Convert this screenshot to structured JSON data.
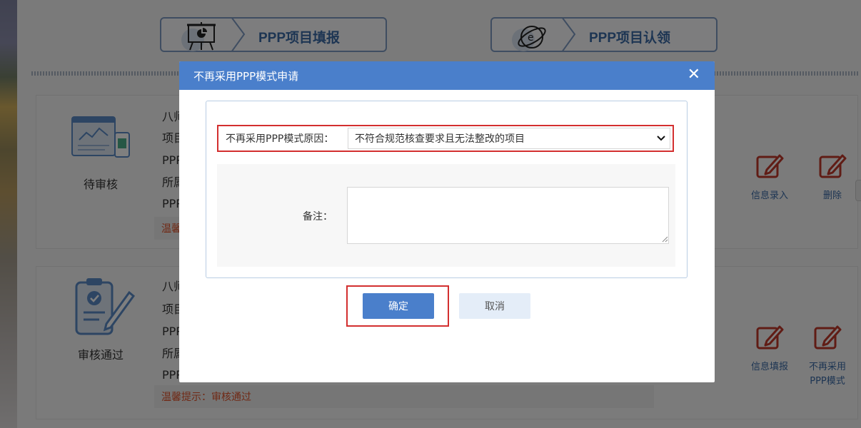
{
  "nav": {
    "fill_label": "PPP项目填报",
    "claim_label": "PPP项目认领"
  },
  "card1": {
    "status": "待审核",
    "lines": [
      "八师备",
      "项目代码",
      "PPP组合",
      "所属行",
      "PPP项目"
    ],
    "tip": "温馨提示",
    "actions": [
      "信息录入",
      "删除"
    ]
  },
  "card2": {
    "status": "审核通过",
    "lines": [
      "八师备",
      "项目代码",
      "PPP组合",
      "所属行",
      "PPP项目"
    ],
    "tip": "温馨提示：审核通过",
    "actions": [
      "信息填报",
      "不再采用",
      "PPP模式"
    ]
  },
  "modal": {
    "title": "不再采用PPP模式申请",
    "close": "✕",
    "reason_label": "不再采用PPP模式原因：",
    "reason_value": "不符合规范核查要求且无法整改的项目",
    "note_label": "备注：",
    "note_value": "",
    "ok": "确定",
    "cancel": "取消"
  },
  "colors": {
    "primary": "#4a7fcb",
    "highlight": "#d32f2f",
    "tip": "#e0522a",
    "action_icon": "#c0392b"
  }
}
